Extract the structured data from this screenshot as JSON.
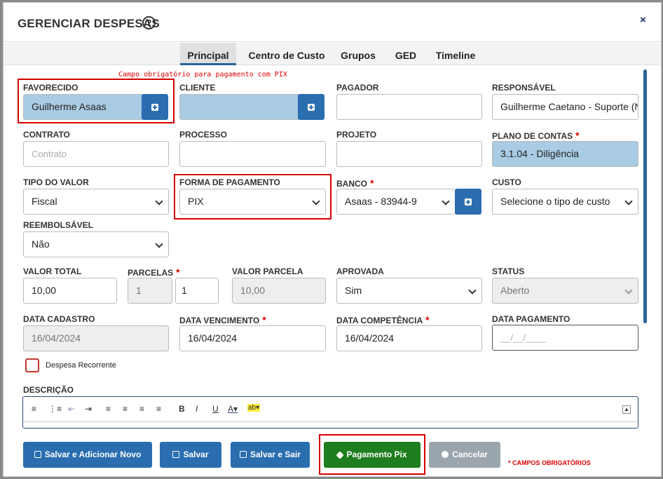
{
  "title": "GERENCIAR DESPESAS",
  "help_icon": "?",
  "close_icon": "×",
  "tabs": [
    "Principal",
    "Centro de Custo",
    "Grupos",
    "GED",
    "Timeline"
  ],
  "note_pix": "Campo obrigatório para pagamento com PIX",
  "fields": {
    "favorecido": {
      "label": "FAVORECIDO",
      "value": "Guilherme Asaas"
    },
    "cliente": {
      "label": "CLIENTE",
      "value": ""
    },
    "pagador": {
      "label": "PAGADOR",
      "value": ""
    },
    "responsavel": {
      "label": "RESPONSÁVEL",
      "value": "Guilherme Caetano - Suporte (N"
    },
    "contrato": {
      "label": "CONTRATO",
      "placeholder": "Contrato"
    },
    "processo": {
      "label": "PROCESSO",
      "value": ""
    },
    "projeto": {
      "label": "PROJETO",
      "value": ""
    },
    "plano_contas": {
      "label": "PLANO DE CONTAS",
      "value": "3.1.04 - Diligência"
    },
    "tipo_valor": {
      "label": "TIPO DO VALOR",
      "value": "Fiscal"
    },
    "forma_pagamento": {
      "label": "FORMA DE PAGAMENTO",
      "value": "PIX"
    },
    "banco": {
      "label": "BANCO",
      "value": "Asaas - 83944-9"
    },
    "custo": {
      "label": "CUSTO",
      "value": "Selecione o tipo de custo"
    },
    "reembolsavel": {
      "label": "REEMBOLSÁVEL",
      "value": "Não"
    },
    "valor_total": {
      "label": "VALOR TOTAL",
      "value": "10,00"
    },
    "parcelas": {
      "label": "PARCELAS",
      "value_a": "1",
      "value_b": "1"
    },
    "valor_parcela": {
      "label": "VALOR PARCELA",
      "value": "10,00"
    },
    "aprovada": {
      "label": "APROVADA",
      "value": "Sim"
    },
    "status": {
      "label": "STATUS",
      "value": "Aberto"
    },
    "data_cadastro": {
      "label": "DATA CADASTRO",
      "value": "16/04/2024"
    },
    "data_vencimento": {
      "label": "DATA VENCIMENTO",
      "value": "16/04/2024"
    },
    "data_competencia": {
      "label": "DATA COMPETÊNCIA",
      "value": "16/04/2024"
    },
    "data_pagamento": {
      "label": "DATA PAGAMENTO",
      "placeholder": "__/__/____"
    },
    "despesa_recorrente": {
      "label": "Despesa Recorrente"
    },
    "descricao": {
      "label": "DESCRIÇÃO"
    }
  },
  "required_mark": "*",
  "buttons": {
    "salvar_novo": "Salvar e Adicionar Novo",
    "salvar": "Salvar",
    "salvar_sair": "Salvar e Sair",
    "pagamento_pix": "Pagamento Pix",
    "cancelar": "Cancelar"
  },
  "required_note": "* CAMPOS OBRIGATÓRIOS",
  "colors": {
    "primary": "#2a6eb0",
    "success": "#1e7e1e",
    "danger": "#d40000",
    "field_highlight": "#a9cbe3"
  }
}
